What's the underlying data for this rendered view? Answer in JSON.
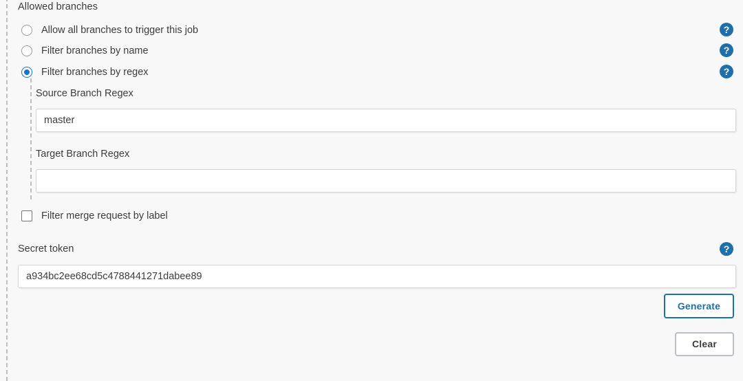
{
  "section": {
    "title": "Allowed branches"
  },
  "radios": [
    {
      "label": "Allow all branches to trigger this job",
      "checked": false,
      "help": "?"
    },
    {
      "label": "Filter branches by name",
      "checked": false,
      "help": "?"
    },
    {
      "label": "Filter branches by regex",
      "checked": true,
      "help": "?"
    }
  ],
  "fields": {
    "source_branch_regex": {
      "label": "Source Branch Regex",
      "value": "master",
      "placeholder": ""
    },
    "target_branch_regex": {
      "label": "Target Branch Regex",
      "value": "",
      "placeholder": ""
    },
    "secret_token": {
      "label": "Secret token",
      "value": "a934bc2ee68cd5c4788441271dabee89",
      "placeholder": "",
      "help": "?"
    }
  },
  "checkbox": {
    "label": "Filter merge request by label",
    "checked": false
  },
  "buttons": {
    "generate": "Generate",
    "clear": "Clear"
  },
  "colors": {
    "page_background": "#f8f8f8",
    "text": "#3c3c3c",
    "accent_blue": "#1f6fab",
    "radio_blue": "#1675d1",
    "input_border": "#d6d6d6",
    "rail_dash": "#bdbdbd",
    "clear_border": "#b9bfc4"
  }
}
